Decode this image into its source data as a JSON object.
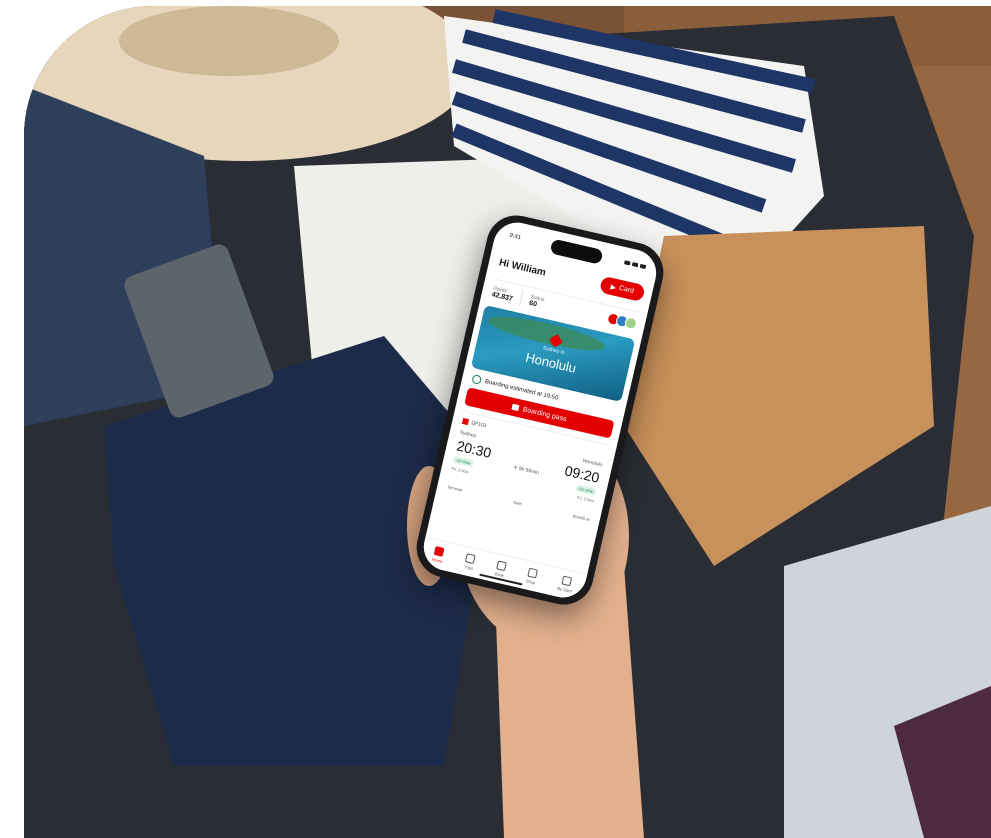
{
  "scene": {
    "description_colors": {
      "wood": "#7a5236",
      "suitcase": "#2a2d33",
      "navy_clothes": "#1d2b4a",
      "stripes_navy": "#1f3566",
      "tan_clothes": "#c8905a",
      "white_clothes": "#eeeeea",
      "skin": "#e3b08e",
      "accent_red": "#e40000"
    }
  },
  "app": {
    "status_time": "9:41",
    "greeting": "Hi William",
    "card_button": "Card",
    "points_label": "Points",
    "points_value": "42,837",
    "status_label": "Status",
    "status_value": "60",
    "route_label": "Sydney to",
    "destination": "Honolulu",
    "boarding_text": "Boarding estimated at 19:50",
    "boarding_pass_button": "Boarding pass",
    "airline": "QF103",
    "from_city": "Sydney",
    "from_time": "20:30",
    "from_status": "On time",
    "from_date": "Fri, 3 Nov",
    "duration": "9h 50min",
    "to_city": "Honolulu",
    "to_time": "09:20",
    "to_status": "On time",
    "to_date": "Fri, 3 Nov",
    "terminal_label": "Terminal",
    "gate_label": "Gate",
    "boards_label": "Boards at",
    "tabs": [
      {
        "label": "Home",
        "icon": "home-icon"
      },
      {
        "label": "Trips",
        "icon": "trips-icon"
      },
      {
        "label": "Book",
        "icon": "search-icon"
      },
      {
        "label": "Shop",
        "icon": "shop-icon"
      },
      {
        "label": "My Qant",
        "icon": "profile-icon"
      }
    ]
  }
}
